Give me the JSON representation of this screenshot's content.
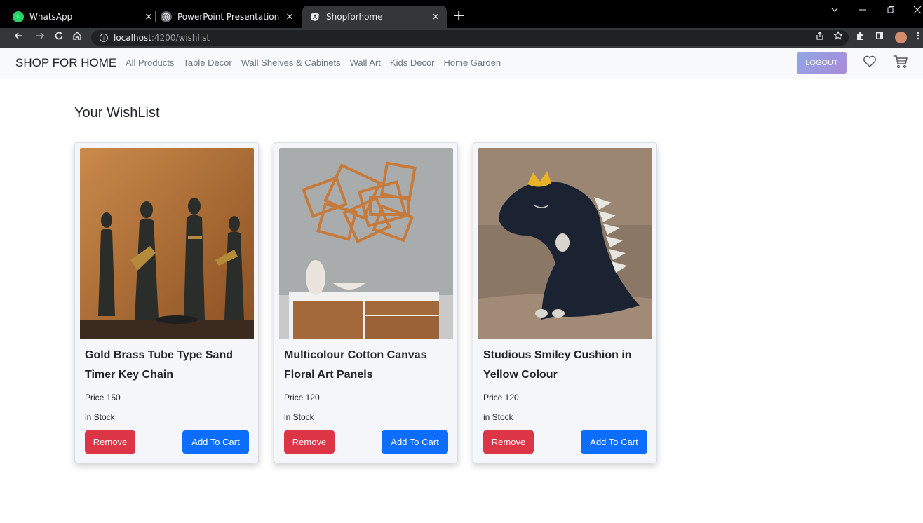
{
  "browser": {
    "tabs": [
      {
        "title": "WhatsApp",
        "icon": "whatsapp-icon"
      },
      {
        "title": "PowerPoint Presentation",
        "icon": "globe-icon"
      },
      {
        "title": "Shopforhome",
        "icon": "angular-icon"
      }
    ],
    "new_tab": "+",
    "url_host": "localhost",
    "url_path": ":4200/wishlist",
    "tab_close": "×"
  },
  "navbar": {
    "brand": "SHOP FOR HOME",
    "links": [
      "All Products",
      "Table Decor",
      "Wall Shelves & Cabinets",
      "Wall Art",
      "Kids Decor",
      "Home Garden"
    ],
    "logout": "LOGOUT"
  },
  "page": {
    "title": "Your WishList"
  },
  "wishlist": [
    {
      "name": "Gold Brass Tube Type Sand Timer Key Chain",
      "price": "Price 150",
      "stock": "in Stock",
      "remove": "Remove",
      "add_to_cart": "Add To Cart"
    },
    {
      "name": "Multicolour Cotton Canvas Floral Art Panels",
      "price": "Price 120",
      "stock": "in Stock",
      "remove": "Remove",
      "add_to_cart": "Add To Cart"
    },
    {
      "name": "Studious Smiley Cushion in Yellow Colour",
      "price": "Price 120",
      "stock": "in Stock",
      "remove": "Remove",
      "add_to_cart": "Add To Cart"
    }
  ],
  "colors": {
    "remove": "#dc3545",
    "add_to_cart": "#0d6efd",
    "navbar_bg": "#f8f9fa",
    "chrome_bg": "#000000"
  }
}
